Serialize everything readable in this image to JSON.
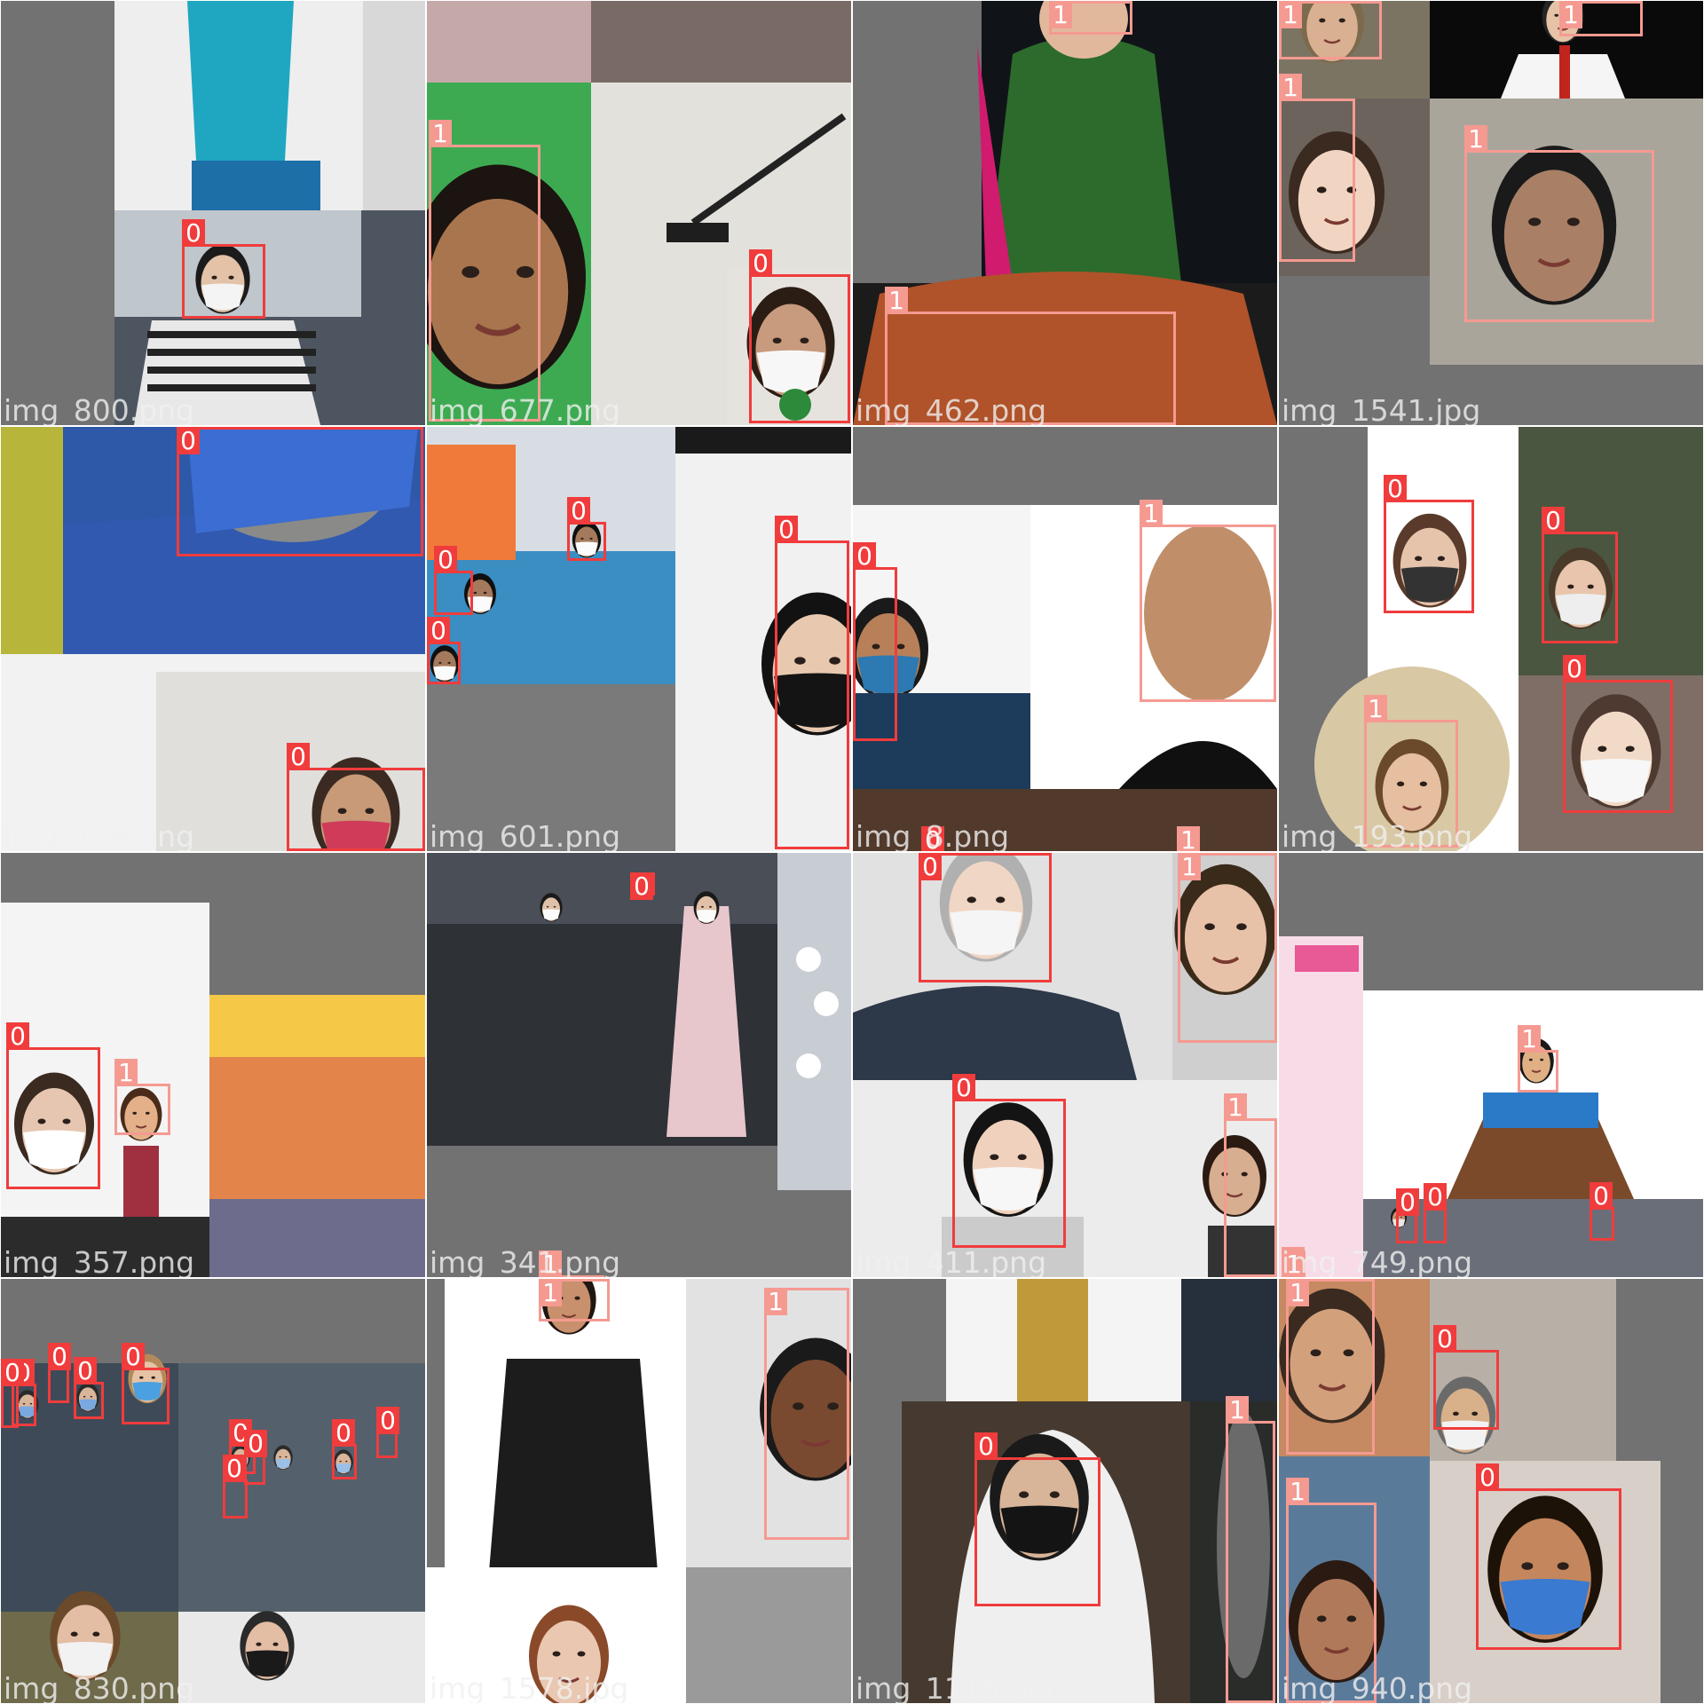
{
  "classes": {
    "0": {
      "label": "0",
      "color": "#f03c3c"
    },
    "1": {
      "label": "1",
      "color": "#f59a91"
    }
  },
  "tiles": [
    {
      "filename": "img_800.png",
      "boxes": [
        {
          "cls": "0",
          "label": "0"
        }
      ]
    },
    {
      "filename": "img_677.png",
      "boxes": [
        {
          "cls": "1",
          "label": "1"
        },
        {
          "cls": "0",
          "label": "0"
        }
      ]
    },
    {
      "filename": "img_462.png",
      "boxes": [
        {
          "cls": "1",
          "label": "1"
        },
        {
          "cls": "1",
          "label": "1"
        }
      ]
    },
    {
      "filename": "img_1541.jpg",
      "boxes": [
        {
          "cls": "1",
          "label": "1"
        },
        {
          "cls": "1",
          "label": "1"
        },
        {
          "cls": "1",
          "label": "1"
        },
        {
          "cls": "1",
          "label": "1"
        }
      ]
    },
    {
      "filename": "img_106.png",
      "boxes": [
        {
          "cls": "0",
          "label": "0"
        },
        {
          "cls": "0",
          "label": "0"
        }
      ]
    },
    {
      "filename": "img_601.png",
      "boxes": [
        {
          "cls": "0",
          "label": "0"
        },
        {
          "cls": "0",
          "label": "0"
        },
        {
          "cls": "0",
          "label": "0"
        },
        {
          "cls": "0",
          "label": "0"
        }
      ]
    },
    {
      "filename": "img_8.png",
      "boxes": [
        {
          "cls": "0",
          "label": "0"
        },
        {
          "cls": "1",
          "label": "1"
        },
        {
          "cls": "0",
          "label": "0"
        },
        {
          "cls": "1",
          "label": "1"
        }
      ]
    },
    {
      "filename": "img_193.png",
      "boxes": [
        {
          "cls": "0",
          "label": "0"
        },
        {
          "cls": "0",
          "label": "0"
        },
        {
          "cls": "1",
          "label": "1"
        },
        {
          "cls": "0",
          "label": "0"
        }
      ]
    },
    {
      "filename": "img_357.png",
      "boxes": [
        {
          "cls": "0",
          "label": "0"
        },
        {
          "cls": "1",
          "label": "1"
        }
      ]
    },
    {
      "filename": "img_341.png",
      "boxes": [
        {
          "cls": "0",
          "label": "0"
        },
        {
          "cls": "1",
          "label": "1"
        }
      ]
    },
    {
      "filename": "img_411.png",
      "boxes": [
        {
          "cls": "0",
          "label": "0"
        },
        {
          "cls": "1",
          "label": "1"
        },
        {
          "cls": "0",
          "label": "0"
        },
        {
          "cls": "1",
          "label": "1"
        }
      ]
    },
    {
      "filename": "img_749.png",
      "boxes": [
        {
          "cls": "1",
          "label": "1"
        },
        {
          "cls": "0",
          "label": "0"
        },
        {
          "cls": "0",
          "label": "0"
        },
        {
          "cls": "0",
          "label": "0"
        },
        {
          "cls": "1",
          "label": "1"
        },
        {
          "cls": "1",
          "label": "1"
        }
      ]
    },
    {
      "filename": "img_830.png",
      "boxes": [
        {
          "cls": "0",
          "label": "0"
        },
        {
          "cls": "0",
          "label": "0"
        },
        {
          "cls": "0",
          "label": "0"
        },
        {
          "cls": "0",
          "label": "0"
        },
        {
          "cls": "0",
          "label": "0"
        },
        {
          "cls": "0",
          "label": "0"
        },
        {
          "cls": "0",
          "label": "0"
        },
        {
          "cls": "0",
          "label": "0"
        },
        {
          "cls": "0",
          "label": "0"
        },
        {
          "cls": "0",
          "label": "0"
        }
      ]
    },
    {
      "filename": "img_1578.jpg",
      "boxes": [
        {
          "cls": "1",
          "label": "1"
        },
        {
          "cls": "1",
          "label": "1"
        }
      ]
    },
    {
      "filename": "img_1118.png",
      "boxes": [
        {
          "cls": "0",
          "label": "0"
        },
        {
          "cls": "1",
          "label": "1"
        }
      ]
    },
    {
      "filename": "img_940.png",
      "boxes": [
        {
          "cls": "1",
          "label": "1"
        },
        {
          "cls": "0",
          "label": "0"
        },
        {
          "cls": "1",
          "label": "1"
        },
        {
          "cls": "0",
          "label": "0"
        }
      ]
    }
  ]
}
